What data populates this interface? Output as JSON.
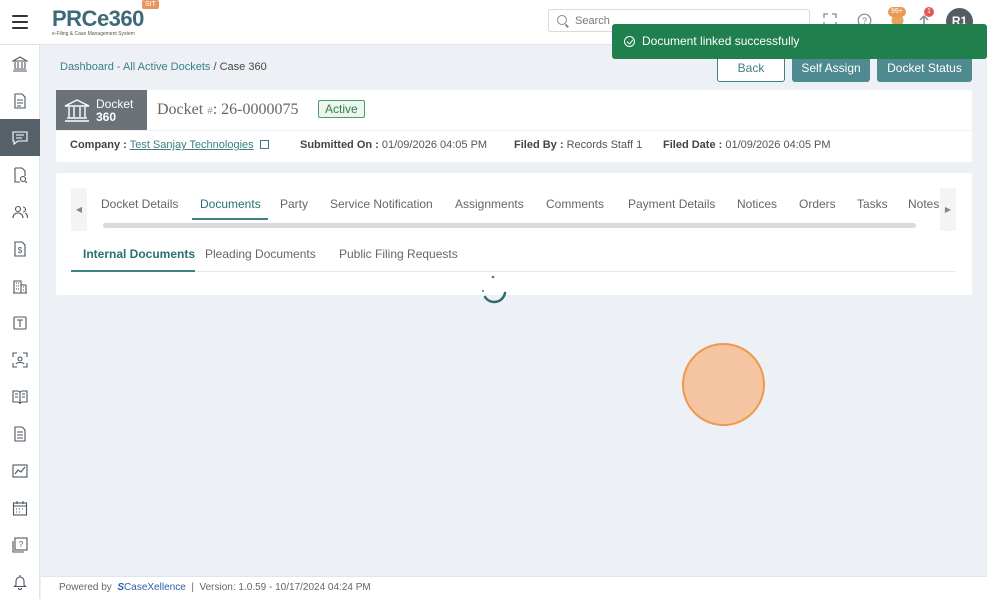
{
  "app": {
    "logo_text": "PRCe360",
    "logo_subtitle": "e-Filing & Case Management System",
    "env_badge": "SIT"
  },
  "header": {
    "search_placeholder": "Search",
    "notifications_badge": "99+",
    "alerts_badge": "1",
    "avatar_initials": "R1"
  },
  "toast": {
    "message": "Document linked successfully"
  },
  "sidebar": {
    "items": [
      {
        "icon": "bank-icon"
      },
      {
        "icon": "document-icon"
      },
      {
        "icon": "chat-icon",
        "active": true
      },
      {
        "icon": "document-search-icon"
      },
      {
        "icon": "users-icon"
      },
      {
        "icon": "dollar-document-icon"
      },
      {
        "icon": "building-icon"
      },
      {
        "icon": "template-icon"
      },
      {
        "icon": "scan-icon"
      },
      {
        "icon": "book-icon"
      },
      {
        "icon": "file-text-icon"
      },
      {
        "icon": "chart-icon"
      },
      {
        "icon": "calendar-icon"
      },
      {
        "icon": "help-icon"
      },
      {
        "icon": "bell-icon"
      }
    ]
  },
  "breadcrumb": {
    "dashboard": "Dashboard",
    "sep1": " - ",
    "all_active": "All Active Dockets",
    "sep2": " / ",
    "current": "Case 360"
  },
  "actions": {
    "back": "Back",
    "self_assign": "Self Assign",
    "docket_status": "Docket Status"
  },
  "docket": {
    "tag_line1": "Docket",
    "tag_line2": "360",
    "title_prefix": "Docket",
    "title_hash": "#",
    "number": ": 26-0000075",
    "status": "Active",
    "company_label": "Company :",
    "company_value": "Test Sanjay Technologies",
    "submitted_label": "Submitted On :",
    "submitted_value": "01/09/2026 04:05 PM",
    "filed_by_label": "Filed By :",
    "filed_by_value": "Records Staff 1",
    "filed_date_label": "Filed Date :",
    "filed_date_value": "01/09/2026 04:05 PM"
  },
  "tabs": [
    {
      "label": "Docket Details"
    },
    {
      "label": "Documents",
      "active": true
    },
    {
      "label": "Party"
    },
    {
      "label": "Service Notification"
    },
    {
      "label": "Assignments"
    },
    {
      "label": "Comments"
    },
    {
      "label": "Payment Details"
    },
    {
      "label": "Notices"
    },
    {
      "label": "Orders"
    },
    {
      "label": "Tasks"
    },
    {
      "label": "Notes"
    }
  ],
  "subtabs": [
    {
      "label": "Internal Documents",
      "active": true
    },
    {
      "label": "Pleading Documents"
    },
    {
      "label": "Public Filing Requests"
    }
  ],
  "footer": {
    "powered_by": "Powered by",
    "brand": "CaseXellence",
    "separator": "|",
    "version": "Version: 1.0.59 - 10/17/2024 04:24 PM"
  },
  "colors": {
    "accent": "#3f8087",
    "toast": "#1f7f4d",
    "sidebar_active": "#556069"
  }
}
